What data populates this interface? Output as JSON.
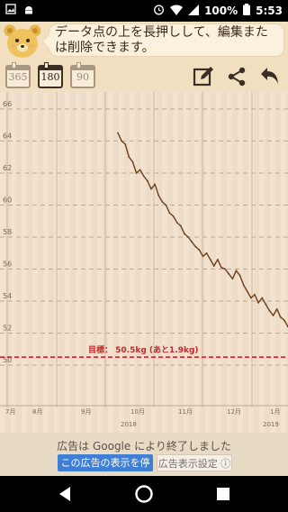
{
  "status_bar": {
    "battery_percent": "100%",
    "time": "5:53"
  },
  "tip": {
    "text": "データ点の上を長押しして、編集または削除できます。"
  },
  "period_buttons": [
    {
      "label": "365",
      "active": false
    },
    {
      "label": "180",
      "active": true
    },
    {
      "label": "90",
      "active": false
    }
  ],
  "chart_data": {
    "type": "line",
    "title": "",
    "xlabel": "",
    "ylabel": "",
    "y_ticks": [
      "66",
      "64",
      "62",
      "60",
      "58",
      "56",
      "54",
      "52",
      "50"
    ],
    "ylim": [
      49.5,
      66.5
    ],
    "x_month_labels": [
      "7月",
      "8月",
      "9月",
      "10月",
      "11月",
      "12月",
      "1月"
    ],
    "x_year_labels": [
      "2018",
      "2019"
    ],
    "target": {
      "value": 50.5,
      "label": "目標： 50.5kg (あと1.9kg)",
      "color": "#c8262a"
    },
    "series": [
      {
        "values": [
          64.5,
          64.0,
          63.8,
          63.0,
          62.7,
          62.0,
          62.2,
          61.8,
          61.5,
          61.0,
          61.3,
          60.6,
          60.2,
          60.0,
          59.5,
          59.3,
          58.9,
          58.7,
          58.2,
          58.0,
          57.7,
          57.4,
          57.2,
          56.8,
          57.0,
          56.6,
          56.2,
          56.6,
          56.1,
          56.0,
          55.7,
          55.4,
          55.9,
          55.6,
          55.0,
          54.6,
          54.2,
          54.4,
          53.9,
          54.2,
          53.8,
          53.4,
          53.1,
          53.5,
          53.0,
          52.8,
          52.4
        ]
      }
    ],
    "grid": true
  },
  "ad": {
    "message": "広告は Google により終了しました",
    "stop_label": "この広告の表示を停止",
    "settings_label": "広告表示設定 ⓘ"
  }
}
